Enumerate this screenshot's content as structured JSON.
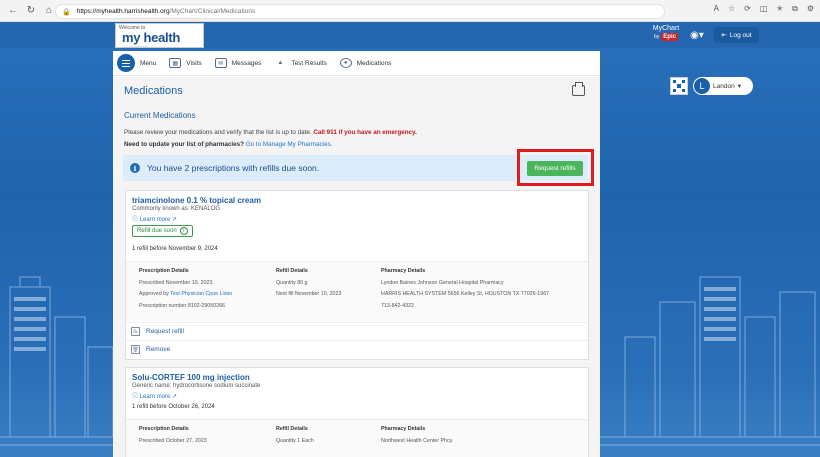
{
  "browser": {
    "url_domain": "https://myhealth.harrishealth.org",
    "url_path": "/MyChart/Clinical/Medications"
  },
  "header": {
    "logo_welcome": "Welcome to",
    "logo_name": "my health",
    "mychart_label": "MyChart",
    "mychart_by": "by",
    "epic_label": "Epic",
    "logout_label": "Log out"
  },
  "menubar": {
    "menu_label": "Menu",
    "items": [
      {
        "label": "Visits",
        "icon": "calendar-icon"
      },
      {
        "label": "Messages",
        "icon": "envelope-icon"
      },
      {
        "label": "Test Results",
        "icon": "flask-icon"
      },
      {
        "label": "Medications",
        "icon": "pills-icon"
      }
    ],
    "user_initial": "L",
    "user_name": "Landon"
  },
  "main": {
    "title": "Medications",
    "section_title": "Current Medications",
    "review_text": "Please review your medications and verify that the list is up to date.",
    "emergency_text": "Call 911 if you have an emergency.",
    "pharmacy_text": "Need to update your list of pharmacies?",
    "pharmacy_link": "Go to Manage My Pharmacies.",
    "banner_text": "You have 2 prescriptions with refills due soon.",
    "request_refills_button": "Request refills",
    "medications": [
      {
        "name": "triamcinolone 0.1 % topical cream",
        "known_as": "Commonly known as: KENALOG",
        "learn_more": "Learn more",
        "badge": "Refill due soon",
        "refill_before": "1 refill before November 9, 2024",
        "prescription_header": "Prescription Details",
        "prescribed": "Prescribed November 10, 2023",
        "approved_by_label": "Approved by",
        "approved_by": "Test Physician Cpoe Lister",
        "prescription_number": "Prescription number 8102-29050266",
        "refill_header": "Refill Details",
        "quantity": "Quantity 80 g",
        "next_fill": "Next fill November 10, 2023",
        "pharmacy_header": "Pharmacy Details",
        "pharmacy_name": "Lyndon Baines Johnson General Hospital Pharmacy",
        "pharmacy_address": "HARRIS HEALTH SYSTEM 5656 Kelley St, HOUSTON TX 77026-1967",
        "pharmacy_phone": "713-842-4322",
        "request_refill": "Request refill",
        "remove": "Remove"
      },
      {
        "name": "Solu-CORTEF 100 mg injection",
        "known_as": "Generic name: hydrocortisone sodium succinate",
        "learn_more": "Learn more",
        "refill_before": "1 refill before October 26, 2024",
        "prescription_header": "Prescription Details",
        "prescribed": "Prescribed October 27, 2023",
        "refill_header": "Refill Details",
        "quantity": "Quantity 1 Each",
        "pharmacy_header": "Pharmacy Details",
        "pharmacy_name": "Northwest Health Center Phcy."
      }
    ]
  },
  "colors": {
    "brand_blue": "#1e5ea5",
    "button_green": "#4ab55a",
    "highlight_red": "#e01b22",
    "emergency_red": "#c5161d"
  }
}
